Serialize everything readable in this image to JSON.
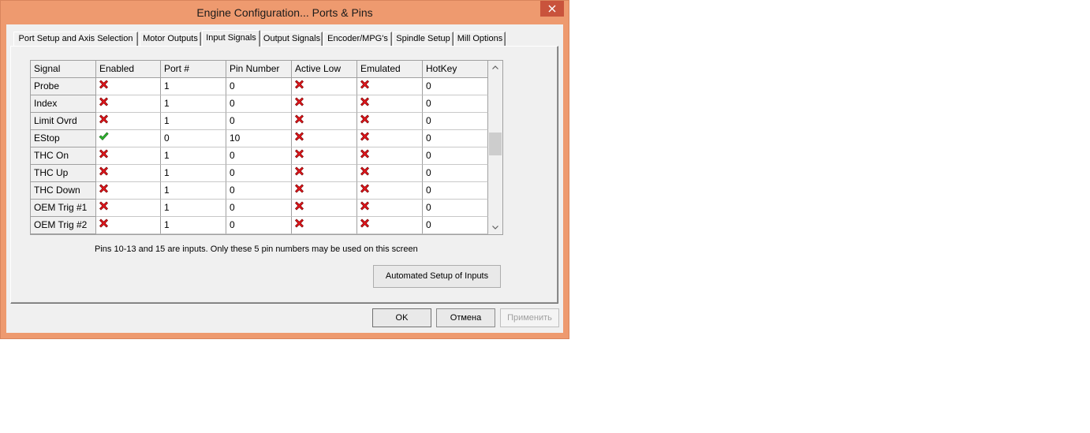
{
  "window": {
    "title": "Engine Configuration... Ports & Pins"
  },
  "colors": {
    "frame": "#EE9A6F",
    "close_button": "#C9533C",
    "face": "#F0F0F0",
    "cross": "#E3161C",
    "check": "#2DB82D"
  },
  "icons": {
    "enabled": "check-icon",
    "disabled": "cross-icon",
    "close": "close-icon",
    "scroll_up": "chevron-up-icon",
    "scroll_down": "chevron-down-icon"
  },
  "tabs": [
    {
      "label": "Port Setup and Axis Selection",
      "selected": false
    },
    {
      "label": "Motor Outputs",
      "selected": false
    },
    {
      "label": "Input Signals",
      "selected": true
    },
    {
      "label": "Output Signals",
      "selected": false
    },
    {
      "label": "Encoder/MPG's",
      "selected": false
    },
    {
      "label": "Spindle Setup",
      "selected": false
    },
    {
      "label": "Mill Options",
      "selected": false
    }
  ],
  "grid": {
    "columns": [
      "Signal",
      "Enabled",
      "Port #",
      "Pin Number",
      "Active Low",
      "Emulated",
      "HotKey"
    ],
    "rows": [
      {
        "signal": "Probe",
        "enabled": false,
        "port": "1",
        "pin": "0",
        "active_low": false,
        "emulated": false,
        "hotkey": "0"
      },
      {
        "signal": "Index",
        "enabled": false,
        "port": "1",
        "pin": "0",
        "active_low": false,
        "emulated": false,
        "hotkey": "0"
      },
      {
        "signal": "Limit Ovrd",
        "enabled": false,
        "port": "1",
        "pin": "0",
        "active_low": false,
        "emulated": false,
        "hotkey": "0"
      },
      {
        "signal": "EStop",
        "enabled": true,
        "port": "0",
        "pin": "10",
        "active_low": false,
        "emulated": false,
        "hotkey": "0"
      },
      {
        "signal": "THC On",
        "enabled": false,
        "port": "1",
        "pin": "0",
        "active_low": false,
        "emulated": false,
        "hotkey": "0"
      },
      {
        "signal": "THC Up",
        "enabled": false,
        "port": "1",
        "pin": "0",
        "active_low": false,
        "emulated": false,
        "hotkey": "0"
      },
      {
        "signal": "THC Down",
        "enabled": false,
        "port": "1",
        "pin": "0",
        "active_low": false,
        "emulated": false,
        "hotkey": "0"
      },
      {
        "signal": "OEM Trig #1",
        "enabled": false,
        "port": "1",
        "pin": "0",
        "active_low": false,
        "emulated": false,
        "hotkey": "0"
      },
      {
        "signal": "OEM Trig #2",
        "enabled": false,
        "port": "1",
        "pin": "0",
        "active_low": false,
        "emulated": false,
        "hotkey": "0"
      }
    ]
  },
  "hint": "Pins 10-13 and 15 are inputs. Only these 5 pin numbers may be used on this screen",
  "buttons": {
    "automated_setup": "Automated Setup of Inputs",
    "ok": "OK",
    "cancel": "Отмена",
    "apply": "Применить",
    "apply_enabled": false
  }
}
